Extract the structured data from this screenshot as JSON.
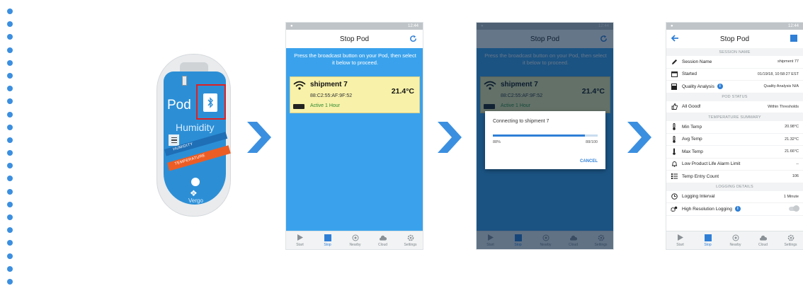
{
  "colors": {
    "accent": "#2f7fd6",
    "arrow": "#3b8fe0",
    "highlight": "#e02020"
  },
  "pod": {
    "label": "Pod",
    "humidity": "Humidity",
    "band_humidity": "HUMIDITY",
    "band_temperature": "TEMPERATURE",
    "brand": "Vergo"
  },
  "status_time": "12:44",
  "screen1": {
    "title": "Stop Pod",
    "instructions": "Press the broadcast button on your Pod, then select it below to proceed.",
    "device": {
      "name": "shipment 7",
      "mac": "88:C2:55:AF:9F:52",
      "temp": "21.4°C",
      "status": "Active 1 Hour"
    }
  },
  "screen2": {
    "dialog_title": "Connecting to shipment 7",
    "progress_percent": 88,
    "progress_label": "88%",
    "progress_count": "88/100",
    "cancel_label": "CANCEL"
  },
  "nav": {
    "start": "Start",
    "stop": "Stop",
    "nearby": "Nearby",
    "cloud": "Cloud",
    "settings": "Settings"
  },
  "screen3": {
    "title": "Stop Pod",
    "sections": {
      "session": "SESSION NAME",
      "pod_status": "POD STATUS",
      "temp_summary": "TEMPERATURE SUMMARY",
      "logging": "LOGGING DETAILS"
    },
    "rows": {
      "session_name": {
        "label": "Session Name",
        "value": "shipment 77"
      },
      "started": {
        "label": "Started",
        "value": "01/19/18, 10:58:27 EST"
      },
      "quality": {
        "label": "Quality Analysis",
        "value": "Quality Analysis N/A"
      },
      "all_good": {
        "label": "All Good!",
        "value": "Within Thresholds"
      },
      "min_temp": {
        "label": "Min Temp",
        "value": "20.98°C"
      },
      "avg_temp": {
        "label": "Avg Temp",
        "value": "21.32°C"
      },
      "max_temp": {
        "label": "Max Temp",
        "value": "21.66°C"
      },
      "low_life": {
        "label": "Low Product Life Alarm Limit",
        "value": "--"
      },
      "entry_count": {
        "label": "Temp Entry Count",
        "value": "106"
      },
      "interval": {
        "label": "Logging Interval",
        "value": "1 Minute"
      },
      "high_res": {
        "label": "High Resolution Logging"
      }
    }
  }
}
